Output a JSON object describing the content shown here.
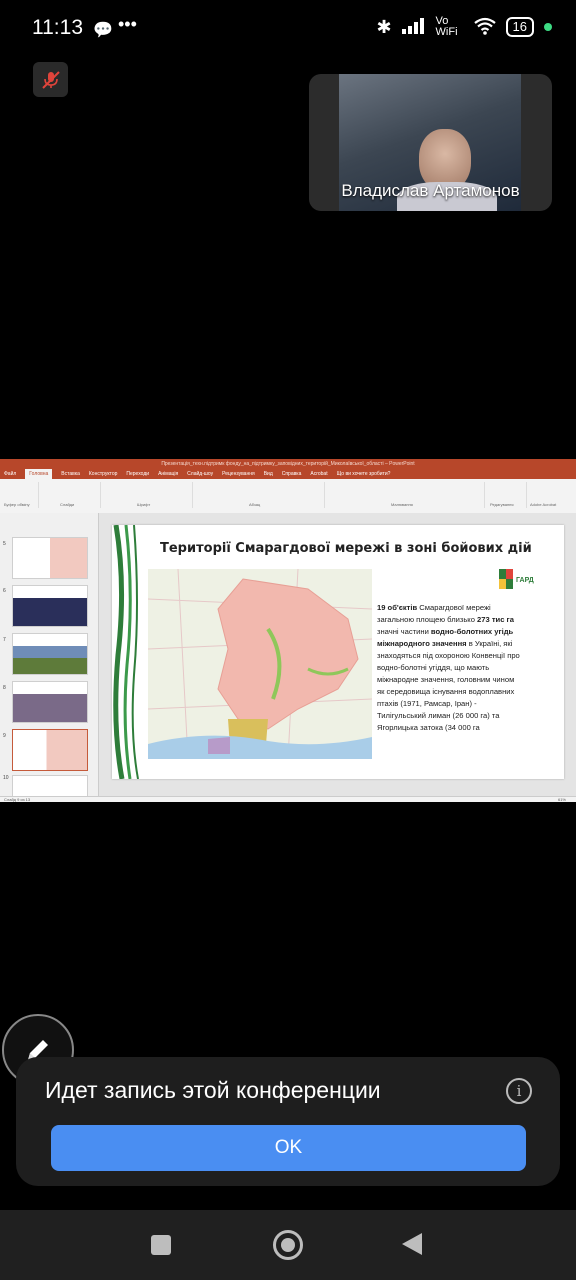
{
  "status_bar": {
    "time": "11:13",
    "network": "Vo WiFi",
    "battery": "16"
  },
  "participant": {
    "name": "Владислав Артамонов"
  },
  "shared_screen": {
    "window_title": "Презентація_техн.підтримк фонду_на_підтримку_заповідних_територій_Миколаївської_області – PowerPoint",
    "ribbon_tabs": [
      "Файл",
      "Головна",
      "Вставка",
      "Конструктор",
      "Переходи",
      "Анімація",
      "Слайд-шоу",
      "Рецензування",
      "Вид",
      "Справка",
      "Acrobat",
      "Що ви хочете зробити?"
    ],
    "ribbon_groups": [
      "Буфер обміну",
      "Слайди",
      "Шрифт",
      "Абзац",
      "Малювання",
      "Редагування",
      "Голос",
      "Adobe Acrobat"
    ],
    "slide": {
      "title": "Території Смарагдової мережі  в зоні бойових дій",
      "text_lead": "19 об'єктів",
      "text_1": " Смарагдової мережі загальною площею близько ",
      "text_area": "273 тис га",
      "text_2": " значні частини ",
      "text_bold": "водно-болотних угідь міжнародного значення",
      "text_3": " в Україні, які знаходяться під охороною Конвенції про водно-болотні угіддя, що мають міжнародне значення, головним чином як середовища існування водоплавних птахів (1971, Рамсар, Іран) -  Тилігульський лиман (26 000 га) та Ягорлицька затока (34 000 га",
      "logo_text": "ГАРД"
    },
    "slide_numbers": [
      "5",
      "6",
      "7",
      "8",
      "9",
      "10"
    ],
    "status_left": "Слайд 9 из 13",
    "status_zoom": "61%"
  },
  "banner": {
    "message": "Идет запись этой конференции",
    "ok_label": "OK"
  },
  "colors": {
    "accent": "#4a8ef2",
    "powerpoint": "#b7472a",
    "banner_bg": "#1e1e1e"
  }
}
